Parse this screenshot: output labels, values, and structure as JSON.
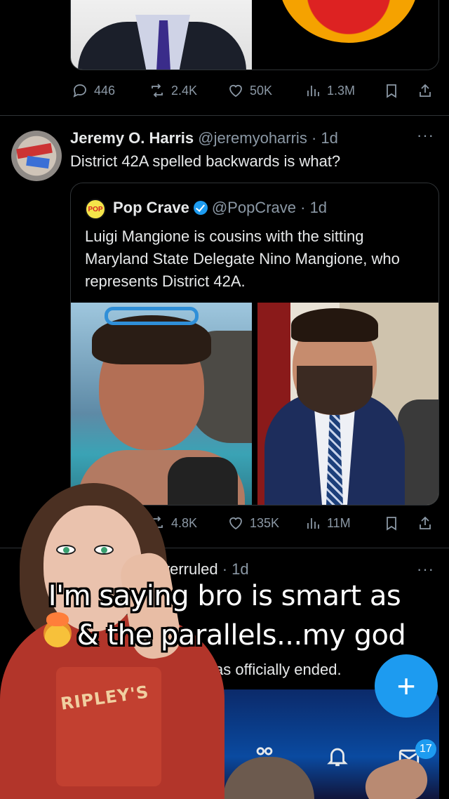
{
  "tweet1_actions": {
    "replies": "446",
    "reposts": "2.4K",
    "likes": "50K",
    "views": "1.3M"
  },
  "tweet2": {
    "name": "Jeremy O. Harris",
    "handle": "@jeremyoharris",
    "time": "· 1d",
    "text": "District 42A spelled backwards is what?",
    "more": "···",
    "quote": {
      "logo_text": "POP",
      "name": "Pop Crave",
      "handle": "@PopCrave",
      "time": "· 1d",
      "text": "Luigi Mangione is cousins with the sitting Maryland State Delegate Nino Mangione, who represents District 42A."
    },
    "actions": {
      "reposts": "4.8K",
      "likes": "135K",
      "views": "11M"
    }
  },
  "tweet3": {
    "name_partial": "Overruled",
    "time": "· 1d",
    "text_partial1": "e",
    "text_partial2": "as officially ended.",
    "more": "···"
  },
  "fab_label": "+",
  "nav": {
    "messages_badge": "17"
  },
  "caption": {
    "line1": "I'm saying bro is smart as",
    "line2": "& the parallels...my god"
  },
  "hoodie_text": "RIPLEY'S"
}
